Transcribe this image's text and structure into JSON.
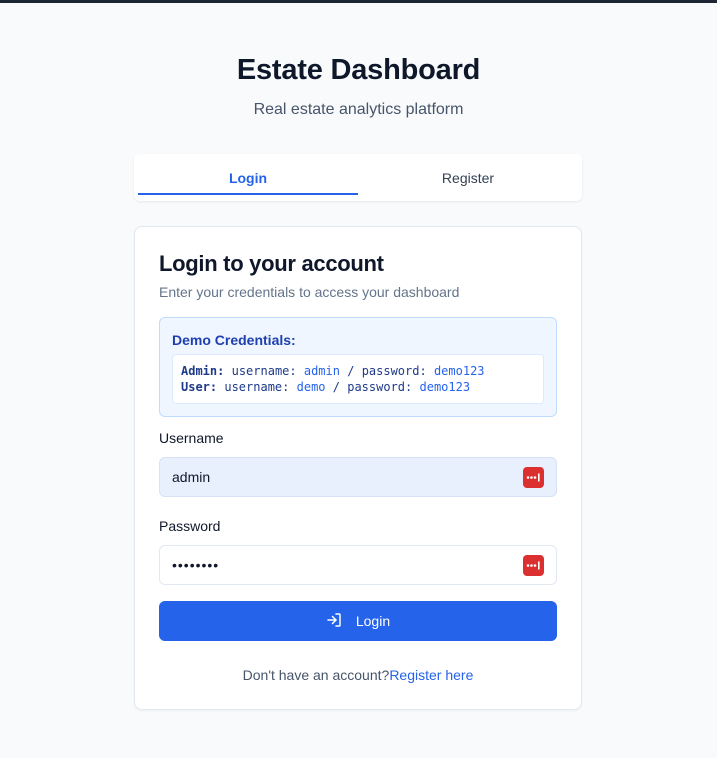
{
  "header": {
    "title": "Estate Dashboard",
    "subtitle": "Real estate analytics platform"
  },
  "tabs": [
    {
      "label": "Login",
      "active": true
    },
    {
      "label": "Register",
      "active": false
    }
  ],
  "card": {
    "title": "Login to your account",
    "description": "Enter your credentials to access your dashboard"
  },
  "demo": {
    "title": "Demo Credentials:",
    "admin": {
      "role": "Admin:",
      "user_key": "username:",
      "user_val": "admin",
      "sep": "/",
      "pass_key": "password:",
      "pass_val": "demo123"
    },
    "user": {
      "role": "User:",
      "user_key": "username:",
      "user_val": "demo",
      "sep": "/",
      "pass_key": "password:",
      "pass_val": "demo123"
    }
  },
  "form": {
    "username_label": "Username",
    "username_value": "admin",
    "password_label": "Password",
    "password_value": "••••••••",
    "password_manager_icon": "password-manager-icon"
  },
  "login_button": {
    "label": "Login",
    "icon": "login-icon"
  },
  "footer": {
    "prompt": "Don't have an account?",
    "link": "Register here"
  },
  "colors": {
    "accent": "#2563eb",
    "background": "#f8fafc",
    "demo_bg": "#eff6ff",
    "password_manager": "#dc2f2f"
  }
}
